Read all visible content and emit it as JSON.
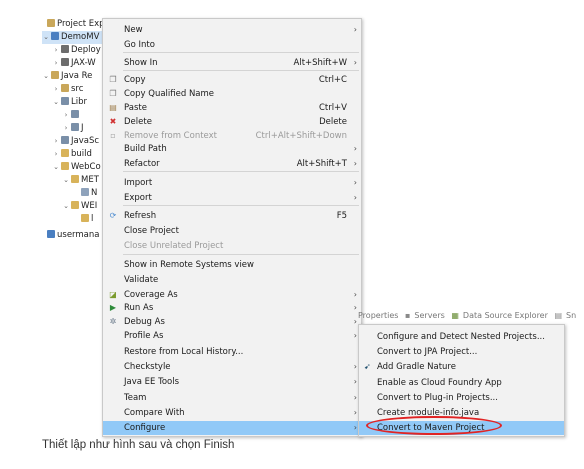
{
  "explorer": {
    "rows": [
      {
        "text": "Project Explor",
        "twisty": "",
        "icon_color": "#c9a75a"
      },
      {
        "text": "DemoMV",
        "twisty": "⌄",
        "icon_color": "#4a7fc1"
      },
      {
        "text": "Deploy",
        "twisty": "›",
        "icon_color": "#6d6d6d"
      },
      {
        "text": "JAX-W",
        "twisty": "›",
        "icon_color": "#6d6d6d"
      },
      {
        "text": "Java Re",
        "twisty": "⌄",
        "icon_color": "#c9a75a"
      },
      {
        "text": "src",
        "twisty": "›",
        "icon_color": "#c9a75a"
      },
      {
        "text": "Libr",
        "twisty": "⌄",
        "icon_color": "#7a8fa8"
      },
      {
        "text": "",
        "twisty": "›",
        "icon_color": "#7a8fa8"
      },
      {
        "text": "J",
        "twisty": "›",
        "icon_color": "#7a8fa8"
      },
      {
        "text": "JavaSc",
        "twisty": "›",
        "icon_color": "#7a8fa8"
      },
      {
        "text": "build",
        "twisty": "›",
        "icon_color": "#d8b35a"
      },
      {
        "text": "WebCo",
        "twisty": "⌄",
        "icon_color": "#d8b35a"
      },
      {
        "text": "MET",
        "twisty": "⌄",
        "icon_color": "#d8b35a"
      },
      {
        "text": "N",
        "twisty": "",
        "icon_color": "#8ea2bb"
      },
      {
        "text": "WEI",
        "twisty": "⌄",
        "icon_color": "#d8b35a"
      },
      {
        "text": "l",
        "twisty": "",
        "icon_color": "#d8b35a"
      },
      {
        "text": "usermana",
        "twisty": "",
        "icon_color": "#4a7fc1"
      }
    ]
  },
  "context_menu": {
    "items": [
      {
        "label": "New",
        "shortcut": "",
        "arrow": "›",
        "icon": "",
        "disabled": false
      },
      {
        "label": "Go Into",
        "shortcut": "",
        "arrow": "",
        "icon": "",
        "disabled": false
      },
      {
        "label": "Show In",
        "shortcut": "Alt+Shift+W",
        "arrow": "›",
        "icon": "",
        "disabled": false
      },
      {
        "label": "Copy",
        "shortcut": "Ctrl+C",
        "arrow": "",
        "icon": "❐",
        "disabled": false
      },
      {
        "label": "Copy Qualified Name",
        "shortcut": "",
        "arrow": "",
        "icon": "❐",
        "disabled": false
      },
      {
        "label": "Paste",
        "shortcut": "Ctrl+V",
        "arrow": "",
        "icon": "▤",
        "disabled": false
      },
      {
        "label": "Delete",
        "shortcut": "Delete",
        "arrow": "",
        "icon": "✖",
        "disabled": false
      },
      {
        "label": "Remove from Context",
        "shortcut": "Ctrl+Alt+Shift+Down",
        "arrow": "",
        "icon": "▫",
        "disabled": true
      },
      {
        "label": "Build Path",
        "shortcut": "",
        "arrow": "›",
        "icon": "",
        "disabled": false
      },
      {
        "label": "Refactor",
        "shortcut": "Alt+Shift+T",
        "arrow": "›",
        "icon": "",
        "disabled": false
      },
      {
        "label": "Import",
        "shortcut": "",
        "arrow": "›",
        "icon": "",
        "disabled": false
      },
      {
        "label": "Export",
        "shortcut": "",
        "arrow": "›",
        "icon": "",
        "disabled": false
      },
      {
        "label": "Refresh",
        "shortcut": "F5",
        "arrow": "",
        "icon": "⟳",
        "disabled": false
      },
      {
        "label": "Close Project",
        "shortcut": "",
        "arrow": "",
        "icon": "",
        "disabled": false
      },
      {
        "label": "Close Unrelated Project",
        "shortcut": "",
        "arrow": "",
        "icon": "",
        "disabled": true
      },
      {
        "label": "Show in Remote Systems view",
        "shortcut": "",
        "arrow": "",
        "icon": "",
        "disabled": false
      },
      {
        "label": "Validate",
        "shortcut": "",
        "arrow": "",
        "icon": "",
        "disabled": false
      },
      {
        "label": "Coverage As",
        "shortcut": "",
        "arrow": "›",
        "icon": "◪",
        "disabled": false
      },
      {
        "label": "Run As",
        "shortcut": "",
        "arrow": "›",
        "icon": "▶",
        "disabled": false
      },
      {
        "label": "Debug As",
        "shortcut": "",
        "arrow": "›",
        "icon": "✲",
        "disabled": false
      },
      {
        "label": "Profile As",
        "shortcut": "",
        "arrow": "›",
        "icon": "",
        "disabled": false
      },
      {
        "label": "Restore from Local History...",
        "shortcut": "",
        "arrow": "",
        "icon": "",
        "disabled": false
      },
      {
        "label": "Checkstyle",
        "shortcut": "",
        "arrow": "›",
        "icon": "",
        "disabled": false
      },
      {
        "label": "Java EE Tools",
        "shortcut": "",
        "arrow": "›",
        "icon": "",
        "disabled": false
      },
      {
        "label": "Team",
        "shortcut": "",
        "arrow": "›",
        "icon": "",
        "disabled": false
      },
      {
        "label": "Compare With",
        "shortcut": "",
        "arrow": "›",
        "icon": "",
        "disabled": false
      },
      {
        "label": "Configure",
        "shortcut": "",
        "arrow": "›",
        "icon": "",
        "disabled": false
      }
    ]
  },
  "tab_strip": {
    "tabs": [
      "Properties",
      "Servers",
      "Data Source Explorer",
      "Sn"
    ]
  },
  "submenu": {
    "items": [
      {
        "label": "Configure and Detect Nested Projects...",
        "icon": ""
      },
      {
        "label": "Convert to JPA Project...",
        "icon": ""
      },
      {
        "label": "Add Gradle Nature",
        "icon": "➹"
      },
      {
        "label": "Enable as Cloud Foundry App",
        "icon": ""
      },
      {
        "label": "Convert to Plug-in Projects...",
        "icon": ""
      },
      {
        "label": "Create module-info.java",
        "icon": ""
      },
      {
        "label": "Convert to Maven Project",
        "icon": ""
      }
    ]
  },
  "colors": {
    "highlight": "#91c9f7",
    "annotation_oval": "#e02424",
    "delete_icon": "#d03030",
    "run_icon": "#2e8b3a"
  },
  "caption": "Thiết lập như hình sau và chọn Finish"
}
